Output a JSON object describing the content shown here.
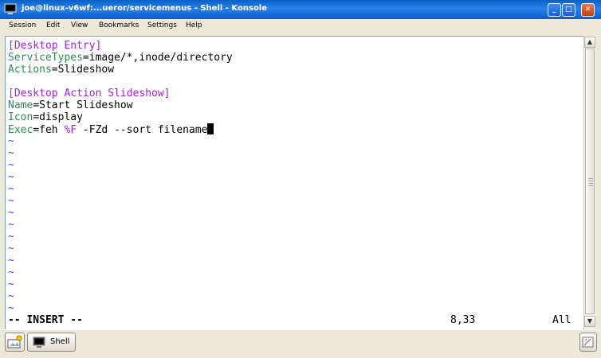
{
  "window": {
    "title": "joe@linux-v6wf:...ueror/servicemenus - Shell - Konsole",
    "minimize_label": "_",
    "maximize_label": "□",
    "close_label": "✕"
  },
  "menu": [
    "Session",
    "Edit",
    "View",
    "Bookmarks",
    "Settings",
    "Help"
  ],
  "editor": {
    "lines": [
      {
        "key": "[Desktop Entry]",
        "sep": "",
        "value": "",
        "kind": "section"
      },
      {
        "key": "ServiceTypes",
        "sep": "=",
        "value": "image/*,inode/directory",
        "kind": "kv"
      },
      {
        "key": "Actions",
        "sep": "=",
        "value": "Slideshow",
        "kind": "kv"
      },
      {
        "key": "",
        "sep": "",
        "value": "",
        "kind": "blank"
      },
      {
        "key": "[Desktop Action Slideshow]",
        "sep": "",
        "value": "",
        "kind": "section"
      },
      {
        "key": "Name",
        "sep": "=",
        "value": "Start Slideshow",
        "kind": "kv"
      },
      {
        "key": "Icon",
        "sep": "=",
        "value": "display",
        "kind": "kv"
      },
      {
        "key": "Exec",
        "sep": "=",
        "value": "feh ",
        "kind": "exec"
      }
    ],
    "exec_arg": "%F",
    "exec_rest": " -FZd --sort filename",
    "tilde": "~",
    "tilde_count": 15,
    "mode": "-- INSERT --",
    "position": "8,33",
    "scroll": "All"
  },
  "scrollbar": {
    "up": "▲",
    "down": "▼"
  },
  "taskbar": {
    "shell_label": "Shell"
  },
  "colors": {
    "section": "#a020f0",
    "key": "#2e8b57",
    "tilde": "#3f3fff",
    "titlebar": "#0a62c8"
  }
}
